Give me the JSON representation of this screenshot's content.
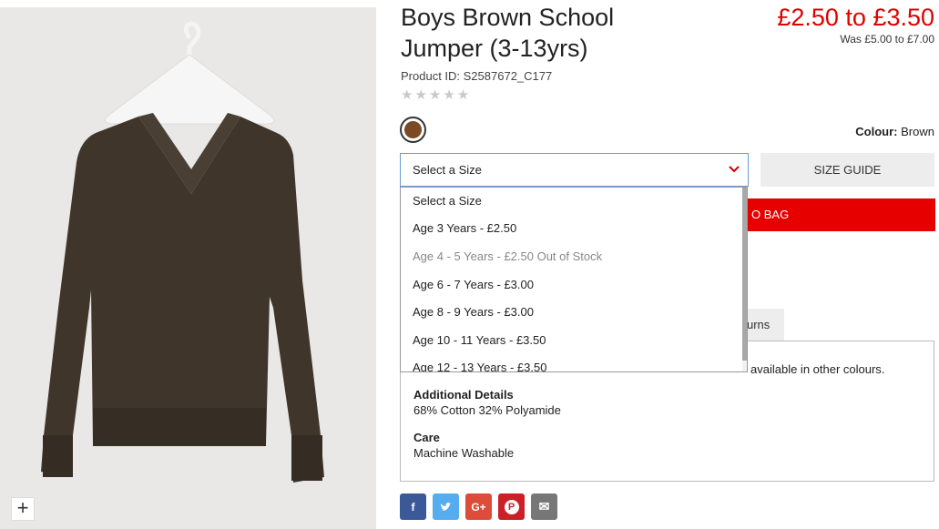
{
  "product": {
    "title": "Boys Brown School Jumper (3-13yrs)",
    "price": "£2.50 to £3.50",
    "was_price": "Was £5.00 to £7.00",
    "product_id": "Product ID: S2587672_C177",
    "rating_stars": "★★★★★",
    "rating_value": 0,
    "rating_max": 5
  },
  "image": {
    "zoom_label": "+"
  },
  "colour": {
    "label": "Colour:",
    "value": "Brown",
    "swatch_color": "#7b4a22"
  },
  "size": {
    "selected": "Select a Size",
    "guide_label": "SIZE GUIDE",
    "options": [
      {
        "label": "Select a Size",
        "in_stock": true
      },
      {
        "label": "Age 3 Years - £2.50",
        "in_stock": true
      },
      {
        "label": "Age 4 - 5 Years - £2.50 Out of Stock",
        "in_stock": false
      },
      {
        "label": "Age 6 - 7 Years - £3.00",
        "in_stock": true
      },
      {
        "label": "Age 8 - 9 Years - £3.00",
        "in_stock": true
      },
      {
        "label": "Age 10 - 11 Years - £3.50",
        "in_stock": true
      },
      {
        "label": "Age 12 - 13 Years - £3.50",
        "in_stock": true
      }
    ]
  },
  "cart": {
    "add_label": "O BAG"
  },
  "tabs": {
    "returns_label": "urns"
  },
  "details": {
    "desc_partial": "available in other colours.",
    "additional_heading": "Additional Details",
    "additional_value": "68% Cotton 32% Polyamide",
    "care_heading": "Care",
    "care_value": "Machine Washable"
  },
  "share": {
    "facebook": "f",
    "twitter": "t",
    "googleplus": "G+",
    "pinterest": "P",
    "email": "✉"
  },
  "colors": {
    "accent_red": "#e00000",
    "button_red": "#e60000",
    "facebook": "#3b5998",
    "twitter": "#55acee",
    "googleplus": "#dd4b39",
    "pinterest": "#cb2027",
    "email": "#777777"
  }
}
